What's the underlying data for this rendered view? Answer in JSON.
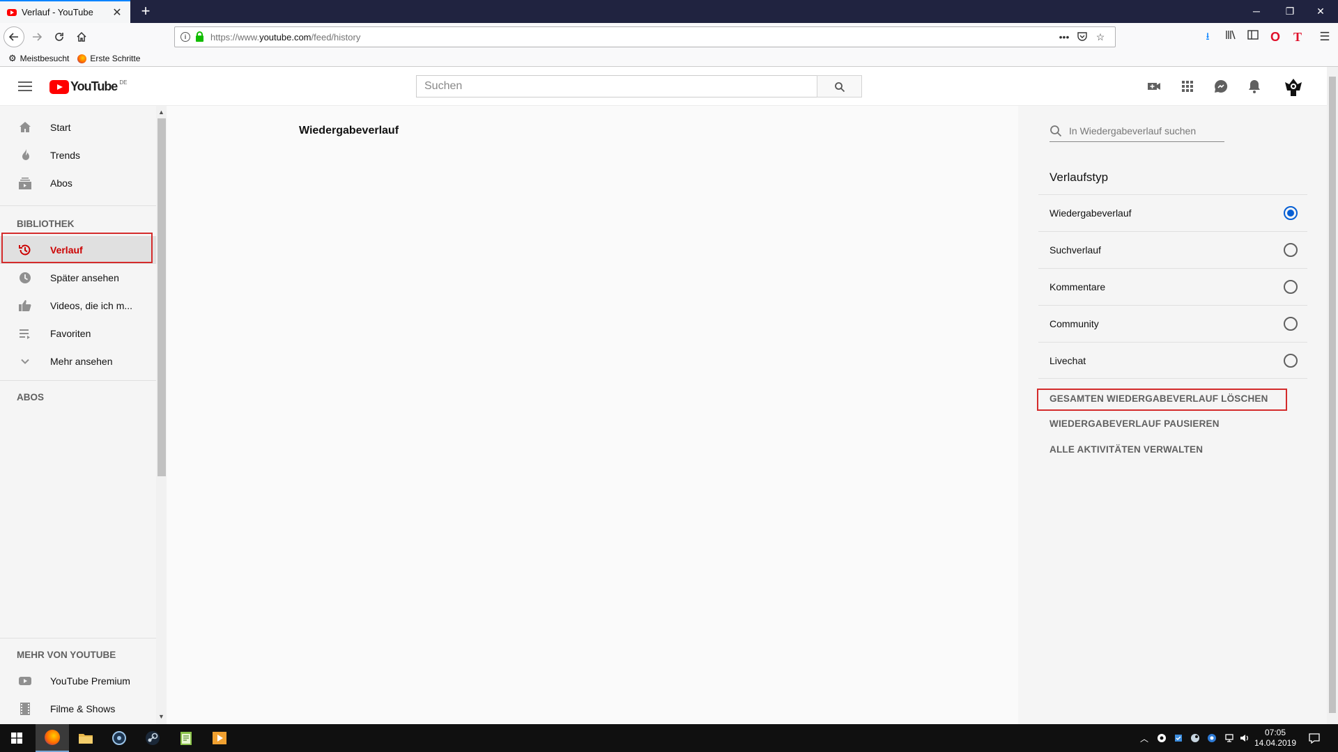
{
  "browser": {
    "tab_title": "Verlauf - YouTube",
    "tab_close": "✕",
    "new_tab": "+",
    "url_prefix": "https://www.",
    "url_domain": "youtube.com",
    "url_path": "/feed/history",
    "page_actions": "•••",
    "bookmarks": [
      {
        "label": "Meistbesucht"
      },
      {
        "label": "Erste Schritte"
      }
    ]
  },
  "masthead": {
    "logo_text": "YouTube",
    "logo_country": "DE",
    "search_placeholder": "Suchen",
    "icons": [
      "create-video-icon",
      "apps-icon",
      "messages-icon",
      "notifications-icon"
    ]
  },
  "guide": {
    "primary": [
      {
        "label": "Start",
        "icon": "home-icon"
      },
      {
        "label": "Trends",
        "icon": "trending-icon"
      },
      {
        "label": "Abos",
        "icon": "subscriptions-icon"
      }
    ],
    "library_heading": "BIBLIOTHEK",
    "library": [
      {
        "label": "Verlauf",
        "icon": "history-icon",
        "active": true
      },
      {
        "label": "Später ansehen",
        "icon": "watch-later-icon"
      },
      {
        "label": "Videos, die ich m...",
        "icon": "liked-videos-icon"
      },
      {
        "label": "Favoriten",
        "icon": "playlist-icon"
      },
      {
        "label": "Mehr ansehen",
        "icon": "chevron-down-icon"
      }
    ],
    "subs_heading": "ABOS",
    "more_heading": "MEHR VON YOUTUBE",
    "more": [
      {
        "label": "YouTube Premium",
        "icon": "youtube-premium-icon"
      },
      {
        "label": "Filme & Shows",
        "icon": "movies-icon"
      }
    ]
  },
  "main": {
    "title": "Wiedergabeverlauf"
  },
  "right_panel": {
    "search_placeholder": "In Wiedergabeverlauf suchen",
    "heading": "Verlaufstyp",
    "history_types": [
      {
        "label": "Wiedergabeverlauf",
        "selected": true
      },
      {
        "label": "Suchverlauf",
        "selected": false
      },
      {
        "label": "Kommentare",
        "selected": false
      },
      {
        "label": "Community",
        "selected": false
      },
      {
        "label": "Livechat",
        "selected": false
      }
    ],
    "actions": [
      {
        "label": "GESAMTEN WIEDERGABEVERLAUF LÖSCHEN"
      },
      {
        "label": "WIEDERGABEVERLAUF PAUSIEREN"
      },
      {
        "label": "ALLE AKTIVITÄTEN VERWALTEN"
      }
    ]
  },
  "taskbar": {
    "time": "07:05",
    "date": "14.04.2019"
  },
  "colors": {
    "accent_red": "#cc0000",
    "highlight_border": "#d42b2b",
    "radio_selected": "#065fd4"
  }
}
